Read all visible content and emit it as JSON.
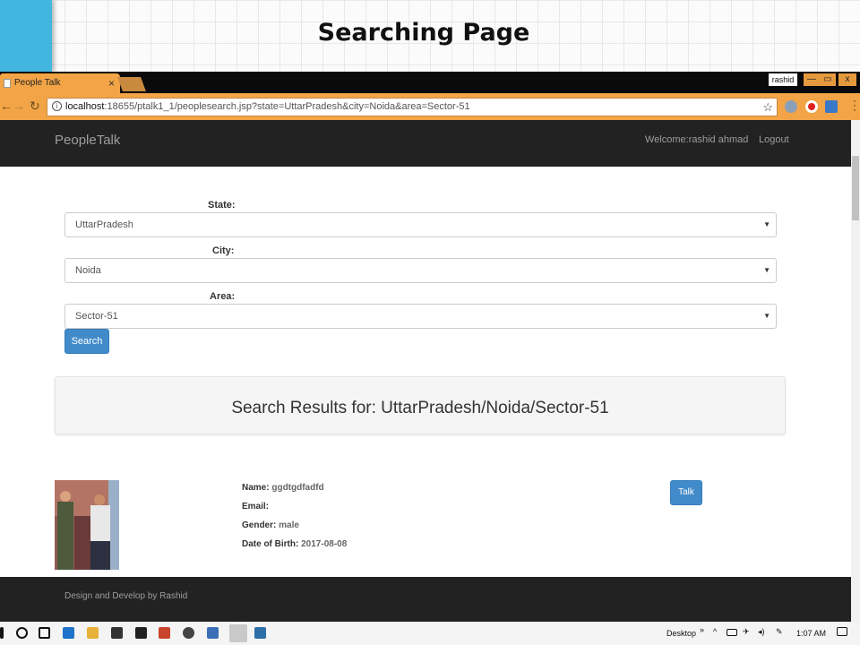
{
  "slide": {
    "title": "Searching Page"
  },
  "browser": {
    "tab_title": "People Talk",
    "tab_close": "×",
    "user": "rashid",
    "url_host": "localhost",
    "url_rest": ":18655/ptalk1_1/peoplesearch.jsp?state=UttarPradesh&city=Noida&area=Sector-51",
    "window_buttons": [
      "—",
      "▭",
      "x"
    ]
  },
  "navbar": {
    "brand": "PeopleTalk",
    "welcome": "Welcome:rashid ahmad",
    "logout": "Logout"
  },
  "form": {
    "state_label": "State:",
    "state_value": "UttarPradesh",
    "city_label": "City:",
    "city_value": "Noida",
    "area_label": "Area:",
    "area_value": "Sector-51",
    "search_button": "Search"
  },
  "results": {
    "heading": "Search Results for: UttarPradesh/Noida/Sector-51",
    "person": {
      "name_label": "Name:",
      "name": "ggdtgdfadfd",
      "email_label": "Email:",
      "email": "",
      "gender_label": "Gender:",
      "gender": "male",
      "dob_label": "Date of Birth:",
      "dob": "2017-08-08",
      "talk_button": "Talk"
    }
  },
  "footer": {
    "text": "Design and Develop by Rashid"
  },
  "taskbar": {
    "desktop_label": "Desktop",
    "overflow": "»",
    "time": "1:07 AM"
  },
  "colors": {
    "accent": "#428bca",
    "navbar": "#222222",
    "browser_chrome": "#f2a446",
    "slide_accent": "#43b6df"
  }
}
